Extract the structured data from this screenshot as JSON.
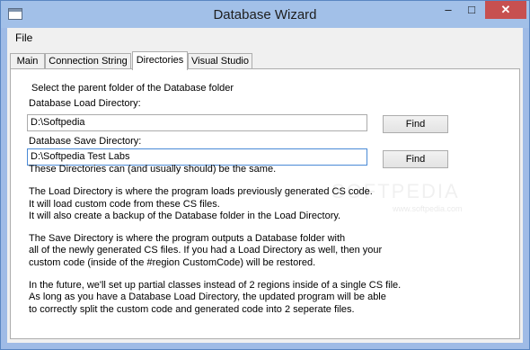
{
  "window": {
    "title": "Database Wizard",
    "minimize": "–",
    "maximize": "□",
    "close": "✕"
  },
  "menu": {
    "file": "File"
  },
  "tabs": [
    {
      "label": "Main"
    },
    {
      "label": "Connection String"
    },
    {
      "label": "Directories"
    },
    {
      "label": "Visual Studio"
    }
  ],
  "directories": {
    "instruction": "Select the parent folder of the Database folder",
    "load_label": "Database Load Directory:",
    "load_value": "D:\\Softpedia",
    "save_label": "Database Save Directory:",
    "save_value": "D:\\Softpedia Test Labs",
    "find_label": "Find",
    "info": [
      "These Directories can (and usually should) be the same.",
      "The Load Directory is where the program loads previously generated CS code.\nIt will load custom code from these CS files.\nIt will also create a backup of the Database folder in the Load Directory.",
      "The Save Directory is where the program outputs a Database folder with\nall of the newly generated CS files. If you had a Load Directory as well, then your\ncustom code (inside of the #region CustomCode) will be restored.",
      "In the future, we'll set up partial classes instead of 2 regions inside of a single CS file.\nAs long as you have a Database Load Directory, the updated program will be able\nto correctly split the custom code and generated code into 2 seperate files."
    ]
  },
  "watermark": {
    "text": "SOFTPEDIA",
    "url": "www.softpedia.com"
  }
}
